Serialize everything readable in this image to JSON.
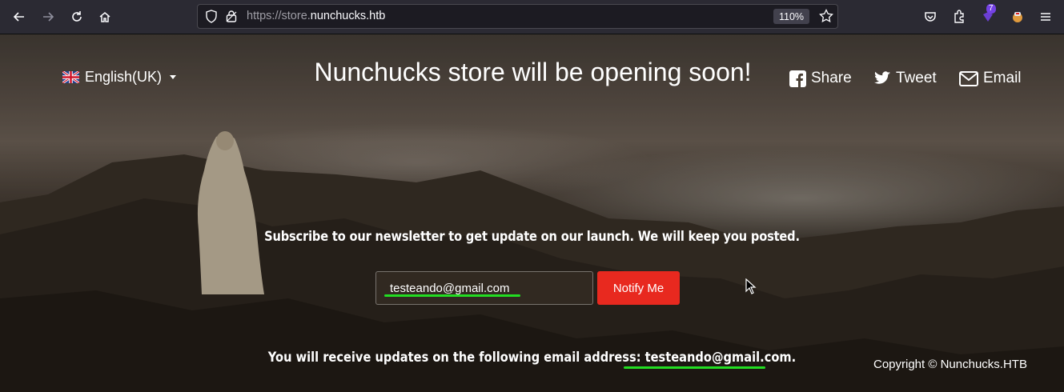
{
  "browser": {
    "url_prefix": "https://store.",
    "url_domain": "nunchucks.htb",
    "zoom": "110%",
    "extension_badge": "7",
    "icons": [
      "back-icon",
      "forward-icon",
      "reload-icon",
      "home-icon",
      "shield-icon",
      "lock-icon",
      "star-icon",
      "pocket-icon",
      "extensions-icon",
      "menu-icon"
    ]
  },
  "page": {
    "language": "English(UK)",
    "headline": "Nunchucks store will be opening soon!",
    "social": {
      "share": "Share",
      "tweet": "Tweet",
      "email": "Email"
    },
    "subscribe_text": "Subscribe to our newsletter to get update on our launch. We will keep you posted.",
    "email_value": "testeando@gmail.com",
    "notify_label": "Notify Me",
    "result_prefix": "You will receive updates on the following email address: ",
    "result_email": "testeando@gmail.com.",
    "copyright": "Copyright © Nunchucks.HTB",
    "colors": {
      "notify_button": "#e8291f",
      "underline": "#22dd22",
      "toolbar": "#2b2a33"
    }
  }
}
